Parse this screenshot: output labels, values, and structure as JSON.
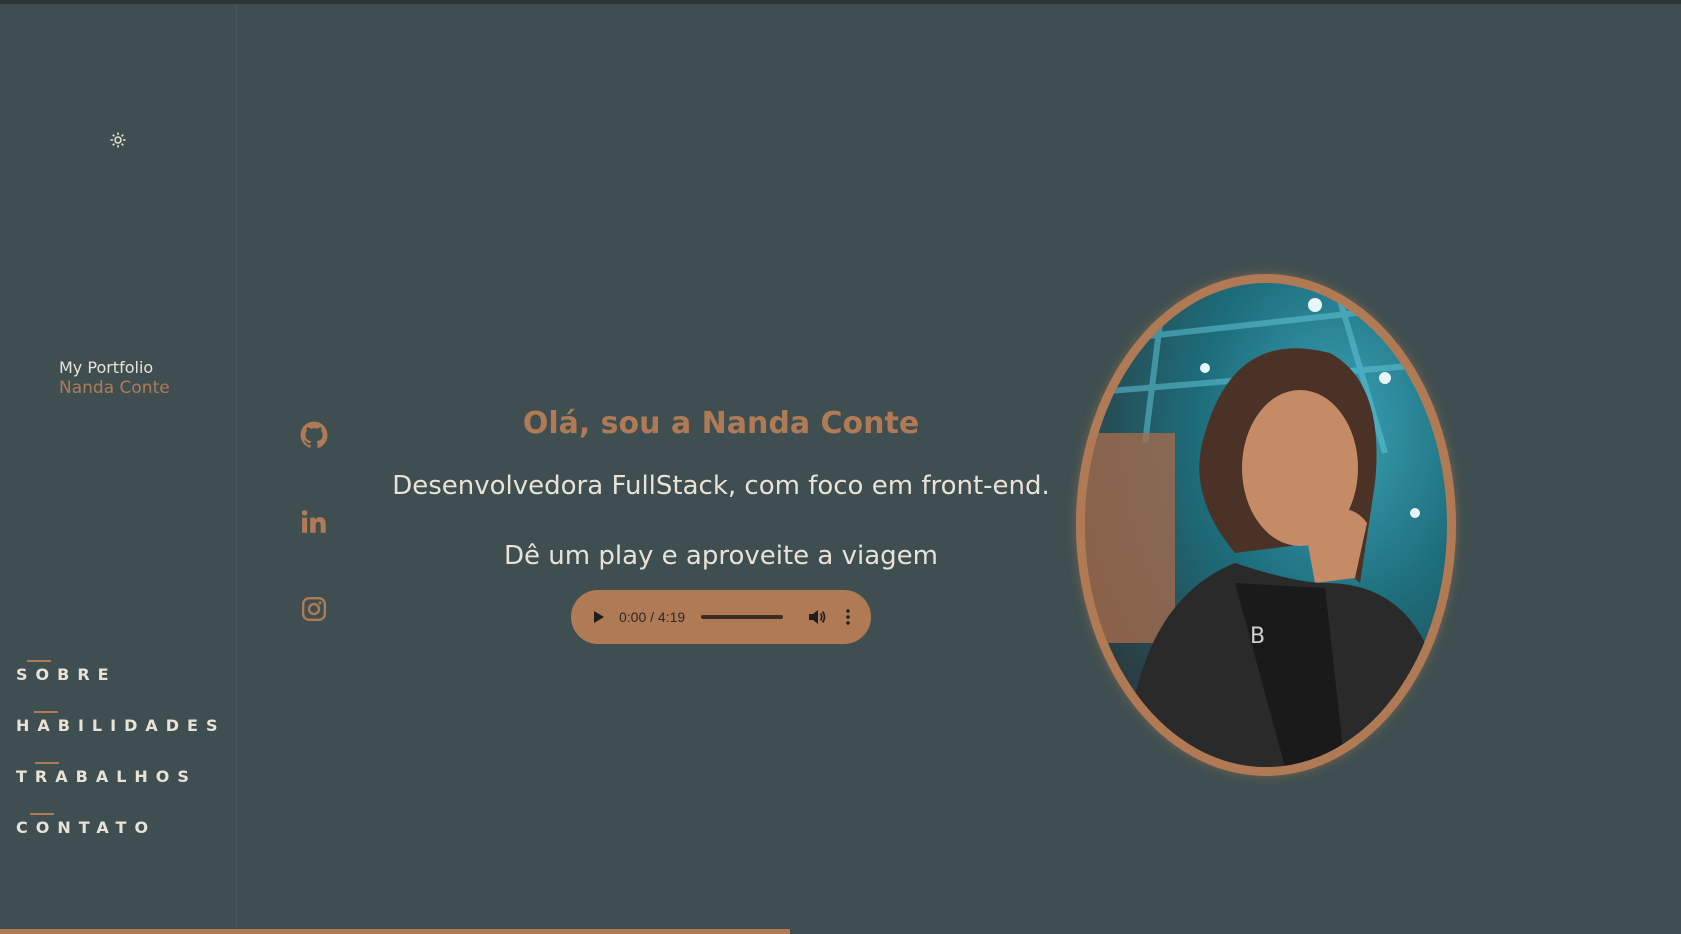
{
  "brand": {
    "line1": "My Portfolio",
    "line2": "Nanda Conte"
  },
  "nav": {
    "items": [
      "SOBRE",
      "HABILIDADES",
      "TRABALHOS",
      "CONTATO"
    ]
  },
  "hero": {
    "greeting": "Olá, sou a Nanda Conte",
    "role": "Desenvolvedora FullStack, com foco em front-end.",
    "cta": "Dê um play e aproveite a viagem"
  },
  "audio": {
    "time": "0:00 / 4:19"
  },
  "colors": {
    "background": "#3f4f51",
    "accent": "#b07a55",
    "text": "#e9e2d6"
  },
  "icons": {
    "theme": "sun-icon",
    "socials": [
      "github-icon",
      "linkedin-icon",
      "instagram-icon"
    ]
  },
  "scroll_progress": 0.47
}
